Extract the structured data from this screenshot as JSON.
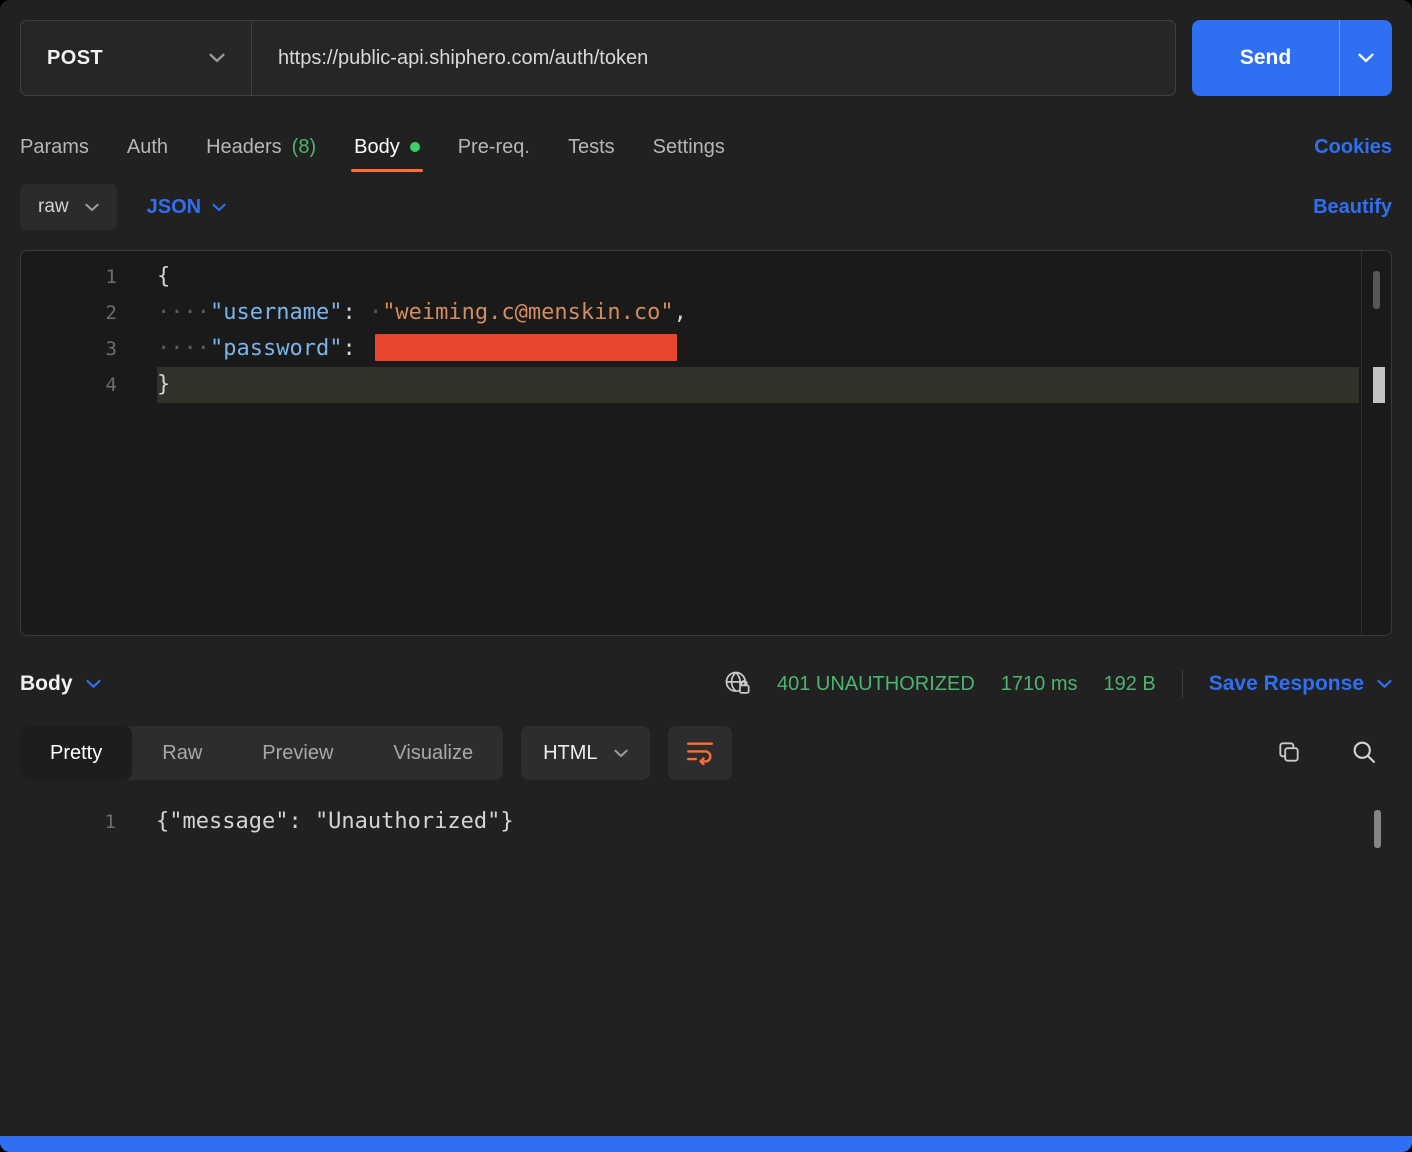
{
  "colors": {
    "accent_blue": "#2f6ff2",
    "postman_orange": "#ff6c37",
    "success_green": "#4cb56f",
    "redaction_red": "#e8472e"
  },
  "request": {
    "method": "POST",
    "url": "https://public-api.shiphero.com/auth/token",
    "send_label": "Send"
  },
  "tabs": {
    "items": [
      {
        "label": "Params"
      },
      {
        "label": "Auth"
      },
      {
        "label": "Headers",
        "count": "(8)"
      },
      {
        "label": "Body"
      },
      {
        "label": "Pre-req."
      },
      {
        "label": "Tests"
      },
      {
        "label": "Settings"
      }
    ],
    "cookies_label": "Cookies"
  },
  "body_toolbar": {
    "format": "raw",
    "language": "JSON",
    "beautify_label": "Beautify"
  },
  "editor": {
    "lines": [
      {
        "num": "1",
        "segments": [
          {
            "type": "punc",
            "text": "{"
          }
        ]
      },
      {
        "num": "2",
        "segments": [
          {
            "type": "ws",
            "text": "····"
          },
          {
            "type": "key",
            "text": "\"username\""
          },
          {
            "type": "punc",
            "text": ": "
          },
          {
            "type": "ws",
            "text": "·"
          },
          {
            "type": "str",
            "text": "\"weiming.c@menskin.co\""
          },
          {
            "type": "punc",
            "text": ","
          }
        ]
      },
      {
        "num": "3",
        "segments": [
          {
            "type": "ws",
            "text": "····"
          },
          {
            "type": "key",
            "text": "\"password\""
          },
          {
            "type": "punc",
            "text": ": "
          },
          {
            "type": "redact",
            "text": ""
          }
        ]
      },
      {
        "num": "4",
        "highlight": true,
        "segments": [
          {
            "type": "punc",
            "text": "}"
          }
        ]
      }
    ]
  },
  "response": {
    "body_label": "Body",
    "status": "401 UNAUTHORIZED",
    "time": "1710 ms",
    "size": "192 B",
    "save_label": "Save Response",
    "view_tabs": [
      "Pretty",
      "Raw",
      "Preview",
      "Visualize"
    ],
    "active_view": "Pretty",
    "language": "HTML",
    "lines": [
      {
        "num": "1",
        "segments": [
          {
            "type": "plain",
            "text": "{\"message\": \"Unauthorized\"}"
          }
        ]
      }
    ]
  }
}
